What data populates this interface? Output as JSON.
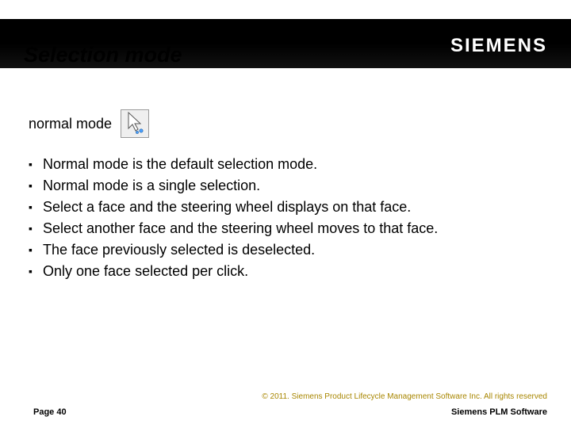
{
  "header": {
    "title": "Selection mode",
    "brand": "SIEMENS"
  },
  "body": {
    "section_label": "normal mode",
    "bullets": [
      "Normal mode is the default selection mode.",
      "Normal mode is a single selection.",
      "Select a face and the steering wheel displays on that face.",
      "Select another face and the steering wheel moves to that face.",
      "The face previously selected is deselected.",
      "Only one face selected per click."
    ]
  },
  "footer": {
    "copyright": "© 2011. Siemens Product Lifecycle Management Software Inc. All rights reserved",
    "page": "Page 40",
    "brand": "Siemens PLM Software"
  }
}
